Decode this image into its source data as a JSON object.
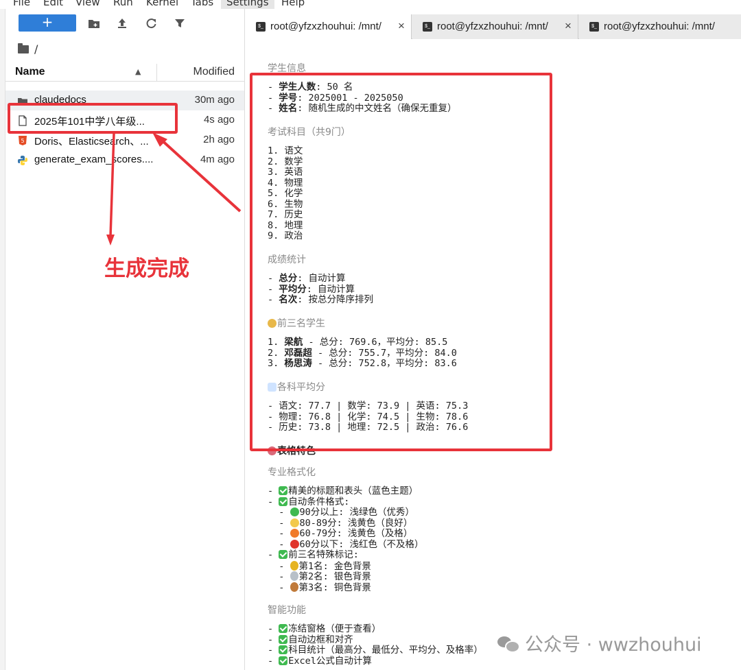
{
  "menubar": {
    "items": [
      "File",
      "Edit",
      "View",
      "Run",
      "Kernel",
      "Tabs",
      "Settings",
      "Help"
    ]
  },
  "filebrowser": {
    "new_label": "+",
    "breadcrumb": "/",
    "columns": {
      "name": "Name",
      "modified": "Modified"
    },
    "files": [
      {
        "name": "claudedocs",
        "modified": "30m ago",
        "icon": "folder-icon"
      },
      {
        "name": "2025年101中学八年级...",
        "modified": "4s ago",
        "icon": "file-icon"
      },
      {
        "name": "Doris、Elasticsearch、...",
        "modified": "2h ago",
        "icon": "html5-icon"
      },
      {
        "name": "generate_exam_scores....",
        "modified": "4m ago",
        "icon": "python-icon"
      }
    ]
  },
  "annotation": {
    "text": "生成完成",
    "color": "#e8333a"
  },
  "tabs": [
    {
      "label": "root@yfzxzhouhui: /mnt/",
      "close": "×"
    },
    {
      "label": "root@yfzxzhouhui: /mnt/",
      "close": "×"
    },
    {
      "label": "root@yfzxzhouhui: /mnt/",
      "close": "×"
    }
  ],
  "doc": {
    "h_student": "学生信息",
    "student_lines": [
      {
        "prefix": "- ",
        "bold": "学生人数",
        "rest": ": 50 名"
      },
      {
        "prefix": "- ",
        "bold": "学号",
        "rest": ": 2025001 - 2025050"
      },
      {
        "prefix": "- ",
        "bold": "姓名",
        "rest": ": 随机生成的中文姓名（确保无重复）"
      }
    ],
    "h_subjects": "考试科目（共9门）",
    "subjects": [
      "1. 语文",
      "2. 数学",
      "3. 英语",
      "4. 物理",
      "5. 化学",
      "6. 生物",
      "7. 历史",
      "8. 地理",
      "9. 政治"
    ],
    "h_stats": "成绩统计",
    "stats_lines": [
      {
        "prefix": "- ",
        "bold": "总分",
        "rest": ": 自动计算"
      },
      {
        "prefix": "- ",
        "bold": "平均分",
        "rest": ": 自动计算"
      },
      {
        "prefix": "- ",
        "bold": "名次",
        "rest": ": 按总分降序排列"
      }
    ],
    "h_top3": "前三名学生",
    "top3": [
      {
        "prefix": "1. ",
        "bold": "梁航",
        "rest": " - 总分: 769.6，平均分: 85.5"
      },
      {
        "prefix": "2. ",
        "bold": "邓磊超",
        "rest": " - 总分: 755.7，平均分: 84.0"
      },
      {
        "prefix": "3. ",
        "bold": "杨思涛",
        "rest": " - 总分: 752.8，平均分: 83.6"
      }
    ],
    "h_avg": "各科平均分",
    "avg_lines": [
      "- 语文: 77.7 | 数学: 73.9 | 英语: 75.3",
      "- 物理: 76.8 | 化学: 74.5 | 生物: 78.6",
      "- 历史: 73.8 | 地理: 72.5 | 政治: 76.6"
    ],
    "h_features": "表格特色",
    "h_format": "专业格式化",
    "format_items": [
      {
        "indent": "- ",
        "mark": "check",
        "text": "精美的标题和表头（蓝色主题）"
      },
      {
        "indent": "- ",
        "mark": "check",
        "text": "自动条件格式:"
      },
      {
        "indent": "  - ",
        "mark": "green-dot",
        "text": "90分以上: 浅绿色（优秀）"
      },
      {
        "indent": "  - ",
        "mark": "yellow-dot",
        "text": "80-89分: 浅黄色（良好）"
      },
      {
        "indent": "  - ",
        "mark": "orange-dot",
        "text": "60-79分: 浅黄色（及格）"
      },
      {
        "indent": "  - ",
        "mark": "red-dot",
        "text": "60分以下: 浅红色（不及格）"
      },
      {
        "indent": "- ",
        "mark": "check",
        "text": "前三名特殊标记:"
      },
      {
        "indent": "  - ",
        "mark": "gold-medal",
        "text": "第1名: 金色背景"
      },
      {
        "indent": "  - ",
        "mark": "silver-medal",
        "text": "第2名: 银色背景"
      },
      {
        "indent": "  - ",
        "mark": "bronze-medal",
        "text": "第3名: 铜色背景"
      }
    ],
    "h_smart": "智能功能",
    "smart_items": [
      {
        "indent": "- ",
        "mark": "check",
        "text": "冻结窗格（便于查看）"
      },
      {
        "indent": "- ",
        "mark": "check",
        "text": "自动边框和对齐"
      },
      {
        "indent": "- ",
        "mark": "check",
        "text": "科目统计（最高分、最低分、平均分、及格率）"
      },
      {
        "indent": "- ",
        "mark": "check",
        "text": "Excel公式自动计算"
      }
    ]
  },
  "watermark": {
    "text": "公众号 · wwzhouhui"
  },
  "colors": {
    "accent": "#2f7ed8",
    "annotation": "#e8333a",
    "check": "#3fb950"
  }
}
